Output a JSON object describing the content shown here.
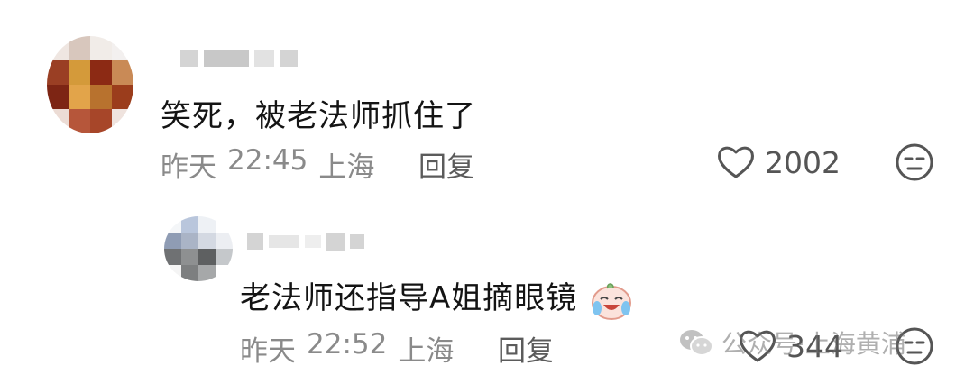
{
  "comments": [
    {
      "text": "笑死，被老法师抓住了",
      "date": "昨天",
      "time": "22:45",
      "location": "上海",
      "reply_label": "回复",
      "likes": "2002"
    },
    {
      "text": "老法师还指导A姐摘眼镜",
      "emoji": "laughing-tears-emoji",
      "date": "昨天",
      "time": "22:52",
      "location": "上海",
      "reply_label": "回复",
      "likes": "344"
    }
  ],
  "watermark": {
    "text": "公众号·上海黄浦"
  },
  "colors": {
    "text": "#141414",
    "meta": "#8a8a8a",
    "icon": "#555555"
  },
  "icons": [
    "heart-icon",
    "dislike-face-icon",
    "wechat-icon"
  ]
}
